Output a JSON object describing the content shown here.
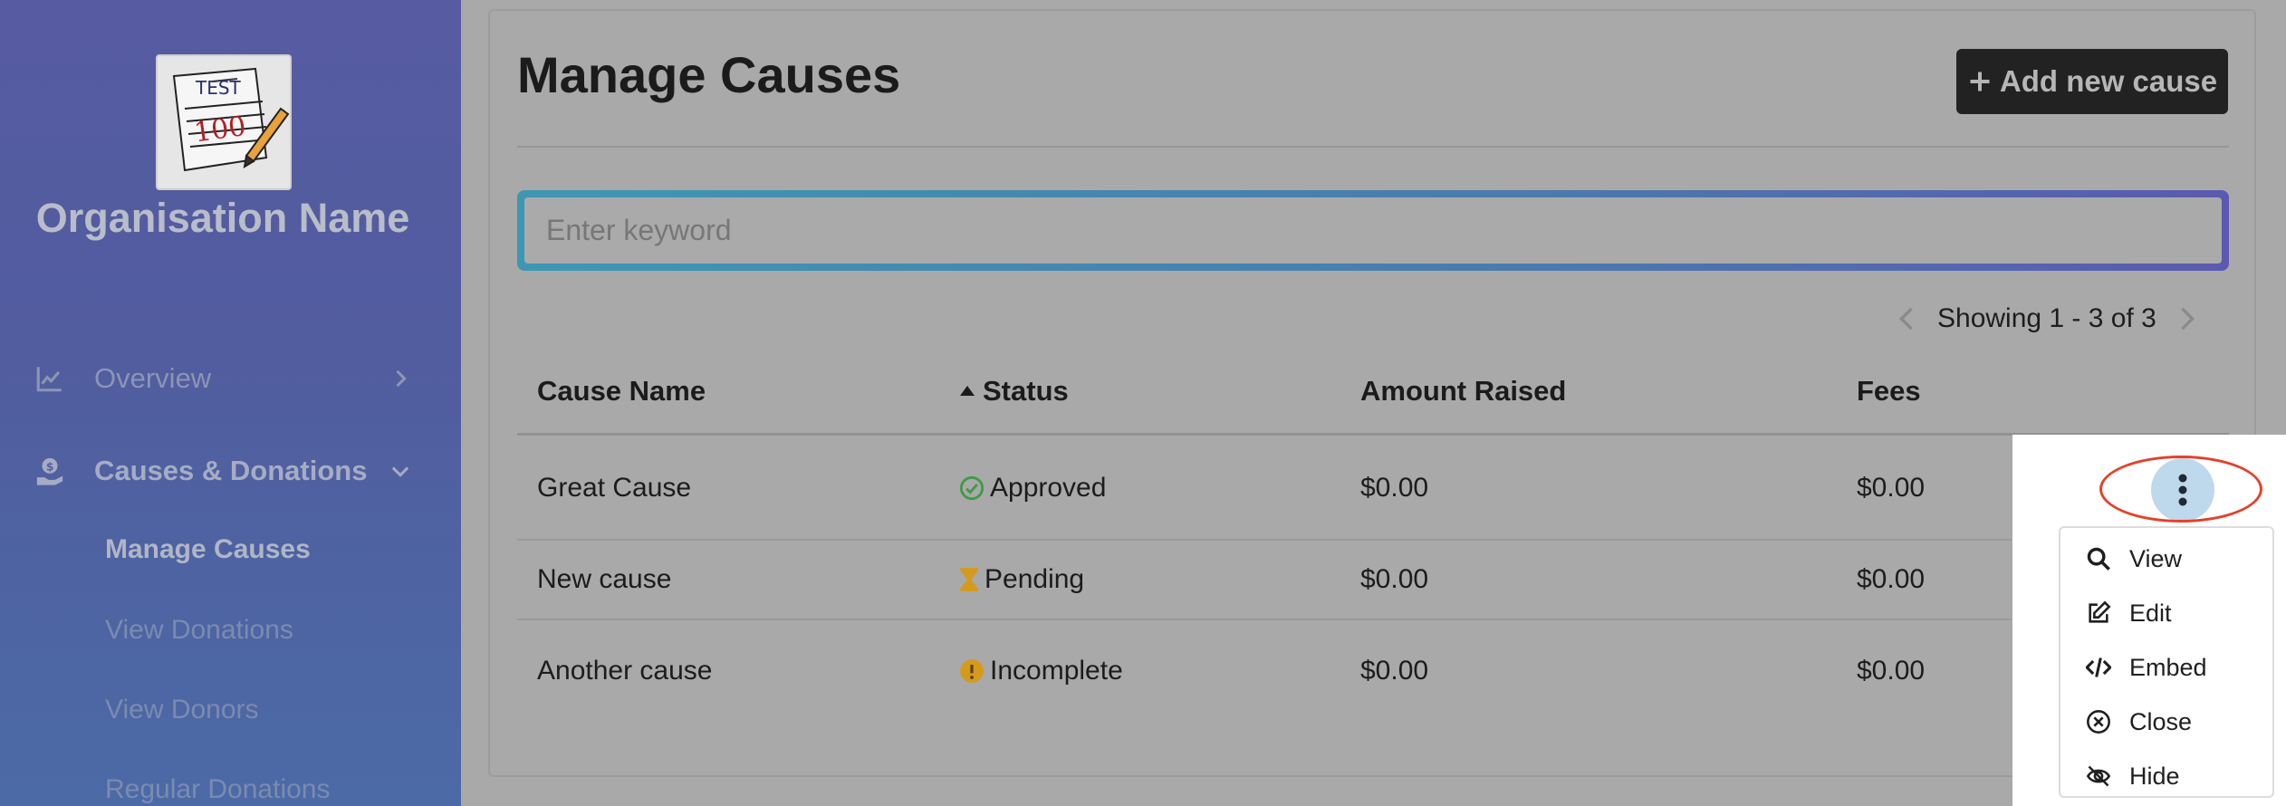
{
  "sidebar": {
    "org_name": "Organisation Name",
    "logo_icon": "test-paper-logo",
    "nav": [
      {
        "label": "Overview",
        "icon": "chart-line-icon",
        "expanded": false
      },
      {
        "label": "Causes & Donations",
        "icon": "donation-hand-icon",
        "expanded": true
      }
    ],
    "sub_items": [
      {
        "label": "Manage Causes",
        "active": true
      },
      {
        "label": "View Donations"
      },
      {
        "label": "View Donors"
      },
      {
        "label": "Regular Donations"
      }
    ]
  },
  "main": {
    "title": "Manage Causes",
    "add_label": "Add new cause",
    "search_placeholder": "Enter keyword",
    "pager_text": "Showing 1 - 3 of 3",
    "columns": [
      "Cause Name",
      "Status",
      "Amount Raised",
      "Fees"
    ],
    "rows": [
      {
        "name": "Great Cause",
        "status": "Approved",
        "status_icon": "check-circle-icon",
        "amount": "$0.00",
        "fees": "$0.00"
      },
      {
        "name": "New cause",
        "status": "Pending",
        "status_icon": "hourglass-icon",
        "amount": "$0.00",
        "fees": "$0.00"
      },
      {
        "name": "Another cause",
        "status": "Incomplete",
        "status_icon": "exclamation-circle-icon",
        "amount": "$0.00",
        "fees": "$0.00"
      }
    ]
  },
  "actions_menu": {
    "items": [
      {
        "label": "View",
        "icon": "search-icon"
      },
      {
        "label": "Edit",
        "icon": "edit-icon"
      },
      {
        "label": "Embed",
        "icon": "code-icon"
      },
      {
        "label": "Close",
        "icon": "close-circle-icon"
      },
      {
        "label": "Hide",
        "icon": "eye-slash-icon"
      }
    ]
  },
  "colors": {
    "approved": "#3f9a46",
    "pending": "#d49a1e",
    "incomplete": "#d49a1e",
    "highlight_ring": "#e4412a"
  }
}
